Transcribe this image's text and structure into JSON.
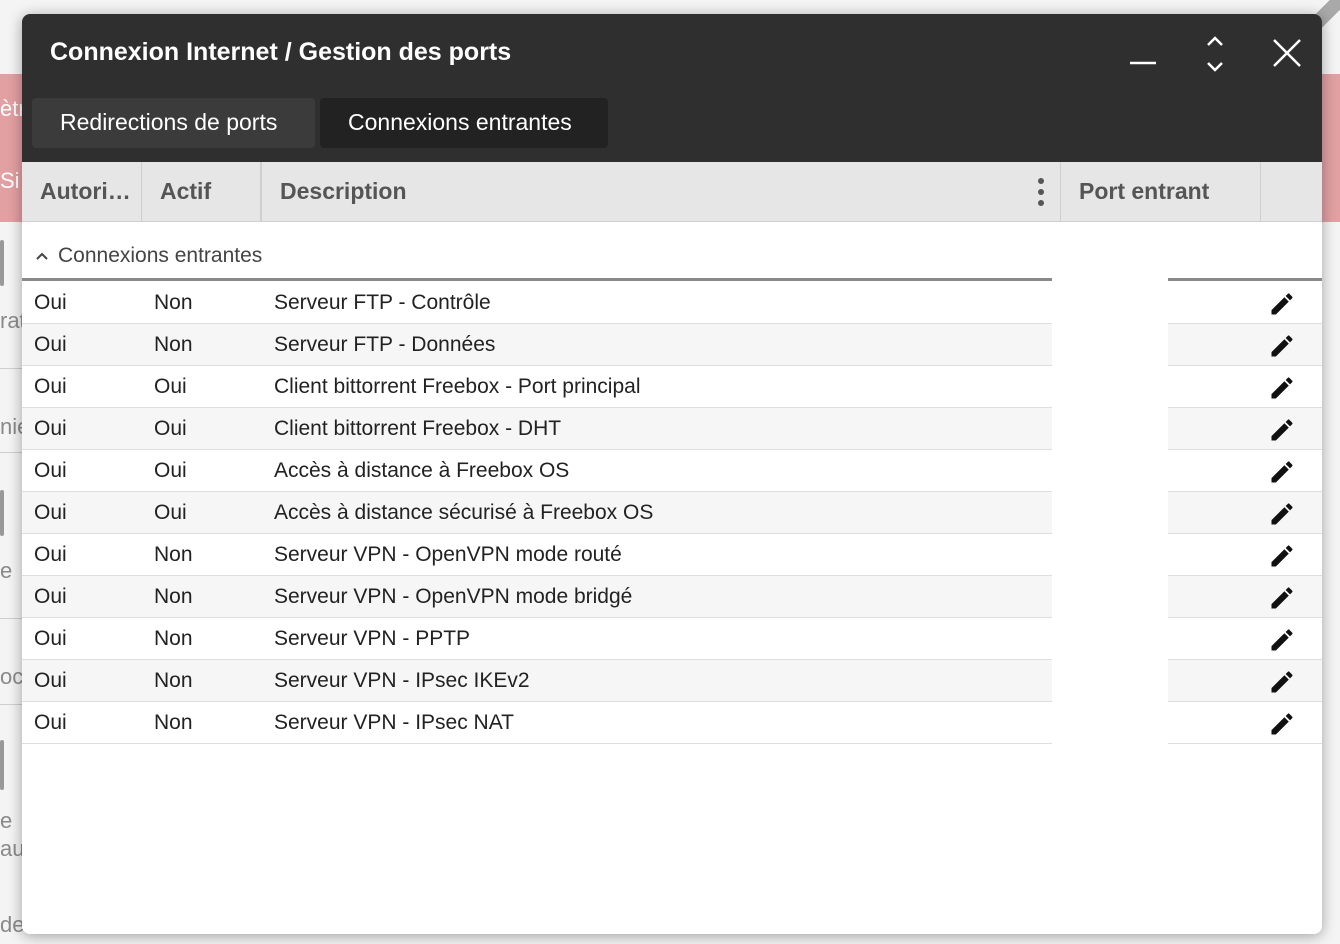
{
  "window": {
    "title": "Connexion Internet / Gestion des ports"
  },
  "tabs": [
    {
      "label": "Redirections de ports",
      "active": false
    },
    {
      "label": "Connexions entrantes",
      "active": true
    }
  ],
  "table": {
    "columns": {
      "authorized": "Autori…",
      "active": "Actif",
      "description": "Description",
      "incoming_port": "Port entrant"
    },
    "group_label": "Connexions entrantes",
    "rows": [
      {
        "authorized": "Oui",
        "active": "Non",
        "description": "Serveur FTP - Contrôle"
      },
      {
        "authorized": "Oui",
        "active": "Non",
        "description": "Serveur FTP - Données"
      },
      {
        "authorized": "Oui",
        "active": "Oui",
        "description": "Client bittorrent Freebox - Port principal"
      },
      {
        "authorized": "Oui",
        "active": "Oui",
        "description": "Client bittorrent Freebox - DHT"
      },
      {
        "authorized": "Oui",
        "active": "Oui",
        "description": "Accès à distance à Freebox OS"
      },
      {
        "authorized": "Oui",
        "active": "Oui",
        "description": "Accès à distance sécurisé à Freebox OS"
      },
      {
        "authorized": "Oui",
        "active": "Non",
        "description": "Serveur VPN - OpenVPN mode routé"
      },
      {
        "authorized": "Oui",
        "active": "Non",
        "description": "Serveur VPN - OpenVPN mode bridgé"
      },
      {
        "authorized": "Oui",
        "active": "Non",
        "description": "Serveur VPN - PPTP"
      },
      {
        "authorized": "Oui",
        "active": "Non",
        "description": "Serveur VPN - IPsec IKEv2"
      },
      {
        "authorized": "Oui",
        "active": "Non",
        "description": "Serveur VPN - IPsec NAT"
      }
    ]
  },
  "background": {
    "fragments": [
      "ètr",
      "Si",
      "rat",
      "nie",
      "e",
      "oc",
      "e",
      "au",
      "de"
    ]
  },
  "icons": {
    "minimize": "minimize-icon",
    "maximize": "expand-collapse-icon",
    "close": "close-icon",
    "column_menu": "vertical-dots-icon",
    "group_toggle": "chevron-up-icon",
    "edit": "pencil-icon"
  },
  "colors": {
    "titlebar": "#2f2f2f",
    "active_tab": "#222222",
    "inactive_tab": "#3b3b3b",
    "header_bg": "#e6e6e6",
    "background_band": "#e2a0a3"
  }
}
